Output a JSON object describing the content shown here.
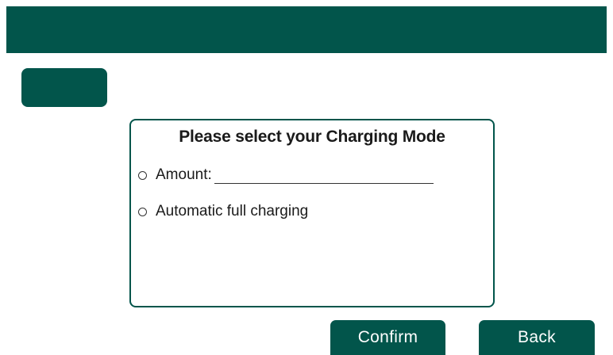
{
  "panel": {
    "title": "Please select your Charging Mode",
    "options": [
      {
        "label": "Amount:",
        "selected": false,
        "input_value": ""
      },
      {
        "label": "Automatic full charging",
        "selected": false
      }
    ]
  },
  "actions": {
    "confirm_label": "Confirm",
    "back_label": "Back"
  },
  "colors": {
    "brand": "#02554b",
    "border": "#02554b",
    "text": "#1a1a1a",
    "button_text": "#ffffff"
  }
}
